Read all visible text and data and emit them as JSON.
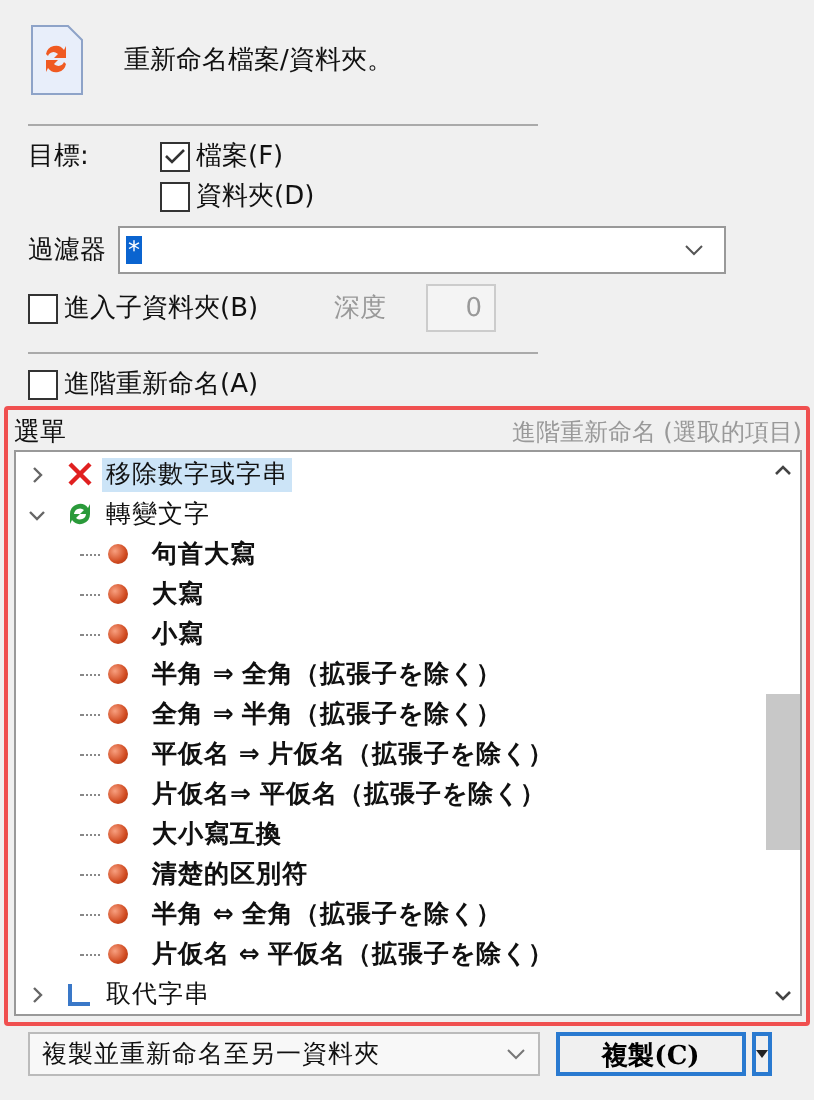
{
  "header": {
    "title": "重新命名檔案/資料夾。"
  },
  "target": {
    "label": "目標:",
    "options": [
      {
        "label": "檔案(F)",
        "checked": true
      },
      {
        "label": "資料夾(D)",
        "checked": false
      }
    ]
  },
  "filter": {
    "label": "過濾器",
    "value": "*"
  },
  "subfolders": {
    "label": "進入子資料夾(B)",
    "checked": false,
    "depth_label": "深度",
    "depth_value": "0",
    "depth_disabled": true
  },
  "advanced": {
    "label": "進階重新命名(A)",
    "checked": false
  },
  "menu_panel": {
    "title": "選單",
    "subtitle": "進階重新命名 (選取的項目)",
    "tree": [
      {
        "label": "移除數字或字串",
        "kind": "remove",
        "expanded": false,
        "selected": true
      },
      {
        "label": "轉變文字",
        "kind": "convert",
        "expanded": true,
        "selected": false,
        "children": [
          {
            "label": "句首大寫",
            "selected": false
          },
          {
            "label": "大寫",
            "selected": false
          },
          {
            "label": "小寫",
            "selected": false
          },
          {
            "label": "半角 ⇒ 全角（拡張子を除く）",
            "selected": false
          },
          {
            "label": "全角 ⇒ 半角（拡張子を除く）",
            "selected": false
          },
          {
            "label": "平仮名 ⇒ 片仮名（拡張子を除く）",
            "selected": false
          },
          {
            "label": "片仮名⇒ 平仮名（拡張子を除く）",
            "selected": false
          },
          {
            "label": "大小寫互換",
            "selected": false
          },
          {
            "label": "清楚的区別符",
            "selected": false
          },
          {
            "label": "半角 ⇔ 全角（拡張子を除く）",
            "selected": false
          },
          {
            "label": "片仮名 ⇔ 平仮名（拡張子を除く）",
            "selected": false
          }
        ]
      },
      {
        "label": "取代字串",
        "kind": "replace",
        "expanded": false,
        "selected": false
      }
    ]
  },
  "footer": {
    "action": "複製並重新命名至另一資料夾",
    "button": "複製(C)"
  }
}
